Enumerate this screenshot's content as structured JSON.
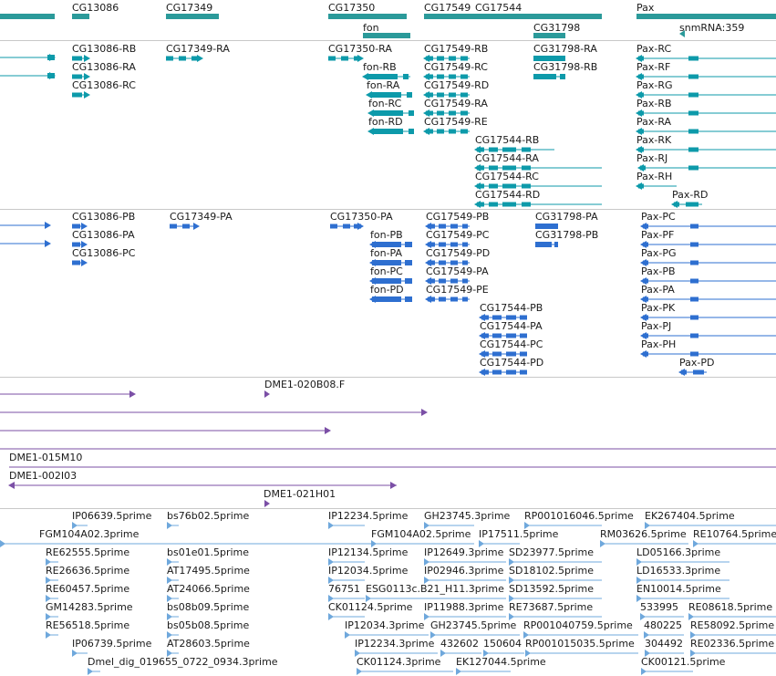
{
  "colors": {
    "gene": "#2b9a9a",
    "transcript": "#0d9aaa",
    "protein": "#2e6fd0",
    "clone": "#7b4fa6",
    "est": "#6fa8dc",
    "separator": "#c8c8c8"
  },
  "tracks": [
    {
      "id": "genes",
      "labels": [
        "CG13086",
        "CG17349",
        "CG17350",
        "CG17549",
        "CG17544",
        "Pax",
        "fon",
        "CG31798",
        "snmRNA:359"
      ]
    },
    {
      "id": "transcripts",
      "labels": [
        "CG13086-RB",
        "CG13086-RA",
        "CG13086-RC",
        "CG17349-RA",
        "CG17350-RA",
        "fon-RB",
        "fon-RA",
        "fon-RC",
        "fon-RD",
        "CG17549-RB",
        "CG17549-RC",
        "CG17549-RD",
        "CG17549-RA",
        "CG17549-RE",
        "CG17544-RB",
        "CG17544-RA",
        "CG17544-RC",
        "CG17544-RD",
        "CG31798-RA",
        "CG31798-RB",
        "Pax-RC",
        "Pax-RF",
        "Pax-RG",
        "Pax-RB",
        "Pax-RA",
        "Pax-RK",
        "Pax-RJ",
        "Pax-RH",
        "Pax-RD"
      ]
    },
    {
      "id": "proteins",
      "labels": [
        "CG13086-PB",
        "CG13086-PA",
        "CG13086-PC",
        "CG17349-PA",
        "CG17350-PA",
        "fon-PB",
        "fon-PA",
        "fon-PC",
        "fon-PD",
        "CG17549-PB",
        "CG17549-PC",
        "CG17549-PD",
        "CG17549-PA",
        "CG17549-PE",
        "CG17544-PB",
        "CG17544-PA",
        "CG17544-PC",
        "CG17544-PD",
        "CG31798-PA",
        "CG31798-PB",
        "Pax-PC",
        "Pax-PF",
        "Pax-PG",
        "Pax-PB",
        "Pax-PA",
        "Pax-PK",
        "Pax-PJ",
        "Pax-PH",
        "Pax-PD"
      ]
    },
    {
      "id": "clones",
      "labels": [
        "DME1-020B08.F",
        "DME1-015M10",
        "DME1-002I03",
        "DME1-021H01"
      ]
    },
    {
      "id": "ests",
      "labels": [
        "IP06639.5prime",
        "bs76b02.5prime",
        "IP12234.5prime",
        "GH23745.3prime",
        "RP001016046.5prime",
        "EK267404.5prime",
        "FGM104A02.3prime",
        "FGM104A02.5prime",
        "IP17511.5prime",
        "RM03626.5prime",
        "RE10764.5prime",
        "RE62555.5prime",
        "bs01e01.5prime",
        "IP12134.5prime",
        "IP12649.3prime",
        "SD23977.5prime",
        "LD05166.3prime",
        "RE26636.5prime",
        "AT17495.5prime",
        "IP12034.5prime",
        "IP02946.3prime",
        "SD18102.5prime",
        "LD16533.3prime",
        "RE60457.5prime",
        "AT24066.5prime",
        "76751",
        "ESG0113c.B21_H11.3prime",
        "SD13592.5prime",
        "EN10014.5prime",
        "GM14283.5prime",
        "bs08b09.5prime",
        "CK01124.5prime",
        "IP11988.3prime",
        "RE73687.5prime",
        "533995",
        "RE08618.5prime",
        "RE56518.5prime",
        "bs05b08.5prime",
        "IP12034.3prime",
        "GH23745.5prime",
        "RP001040759.5prime",
        "480225",
        "RE58092.5prime",
        "IP06739.5prime",
        "AT28603.5prime",
        "IP12234.3prime",
        "432602",
        "150604",
        "RP001015035.5prime",
        "304492",
        "RE02336.5prime",
        "Dmel_dig_019655_0722_0934.3prime",
        "CK01124.3prime",
        "EK127044.5prime",
        "CK00121.5prime"
      ]
    }
  ]
}
